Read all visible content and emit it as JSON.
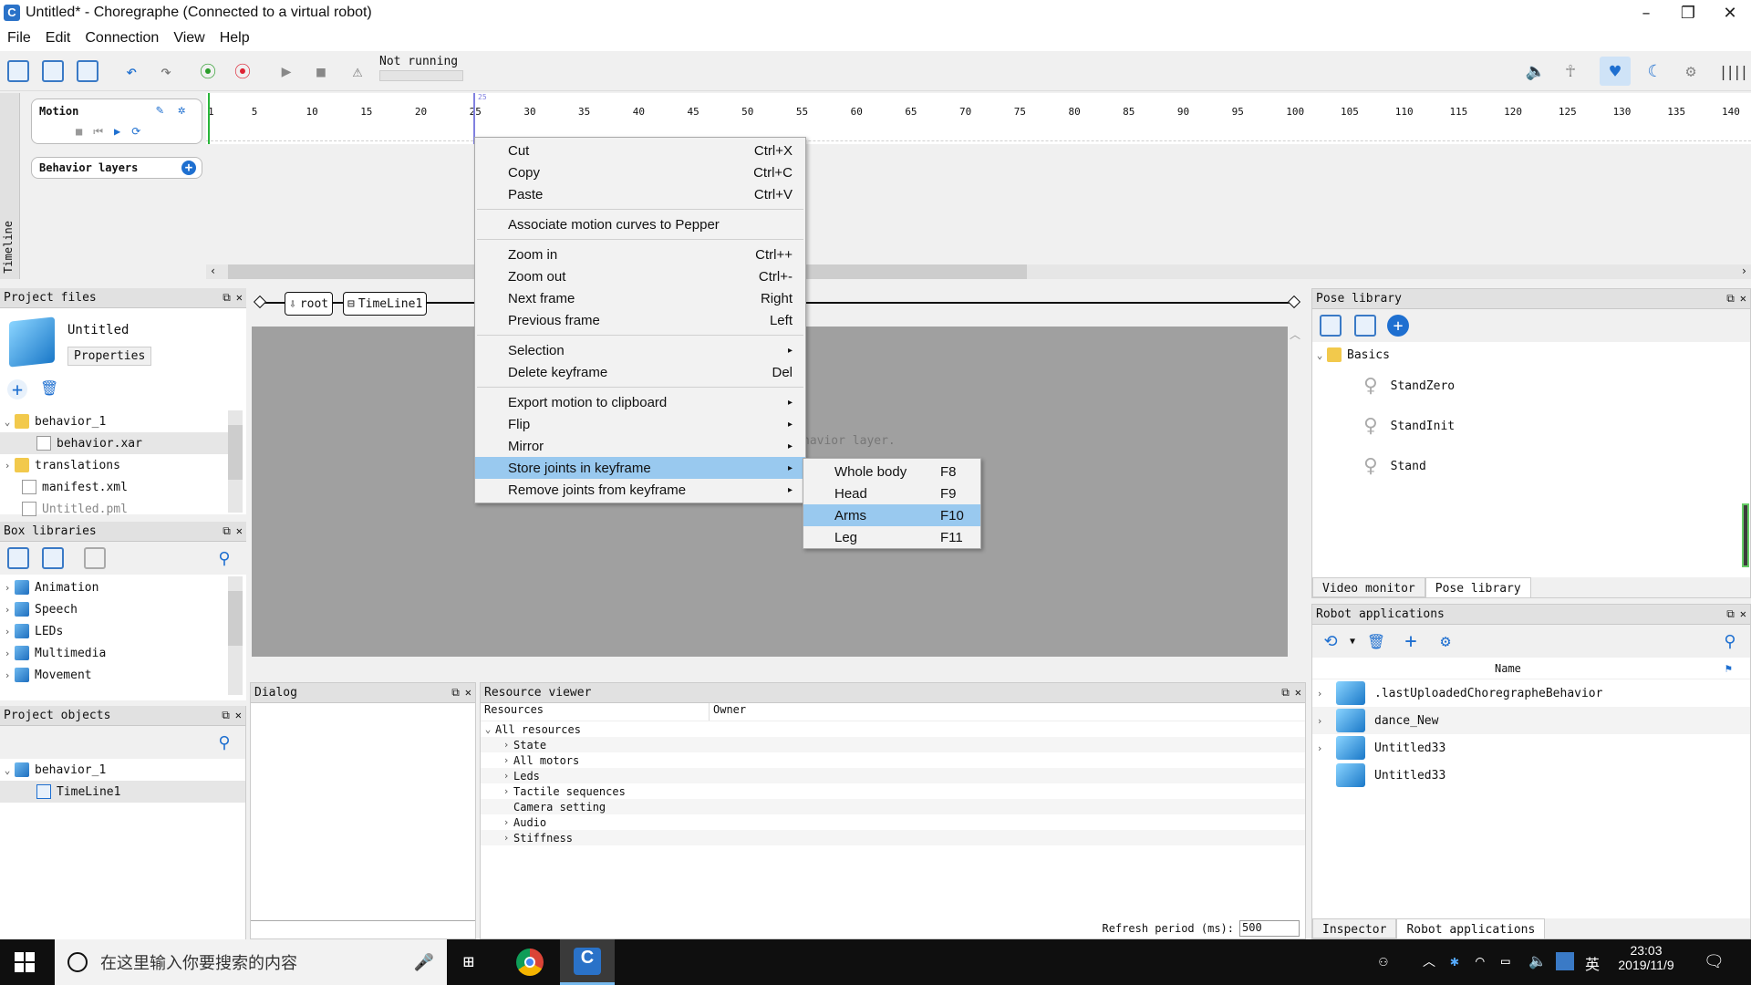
{
  "window": {
    "title": "Untitled* - Choregraphe (Connected to a virtual robot)",
    "app_icon": "C"
  },
  "menu": [
    "File",
    "Edit",
    "Connection",
    "View",
    "Help"
  ],
  "toolbar": {
    "status": "Not running"
  },
  "timeline": {
    "vertical_label": "Timeline",
    "motion_label": "Motion",
    "behavior_layers": "Behavior layers",
    "ticks": [
      "1",
      "5",
      "10",
      "15",
      "20",
      "25",
      "30",
      "35",
      "40",
      "45",
      "50",
      "55",
      "60",
      "65",
      "70",
      "75",
      "80",
      "85",
      "90",
      "95",
      "100",
      "105",
      "110",
      "115",
      "120",
      "125",
      "130",
      "135",
      "140"
    ],
    "cursor_label": "25"
  },
  "breadcrumb": {
    "root": "root",
    "timeline": "TimeLine1"
  },
  "project_files": {
    "header": "Project files",
    "project_name": "Untitled",
    "properties_btn": "Properties",
    "tree": [
      {
        "label": "behavior_1",
        "kind": "folder",
        "expanded": true
      },
      {
        "label": "behavior.xar",
        "kind": "file",
        "selected": true
      },
      {
        "label": "translations",
        "kind": "folder",
        "expanded": false
      },
      {
        "label": "manifest.xml",
        "kind": "xml"
      },
      {
        "label": "Untitled.pml",
        "kind": "pml"
      }
    ]
  },
  "box_libraries": {
    "header": "Box libraries",
    "items": [
      "Animation",
      "Speech",
      "LEDs",
      "Multimedia",
      "Movement"
    ]
  },
  "project_objects": {
    "header": "Project objects",
    "tree": [
      {
        "label": "behavior_1"
      },
      {
        "label": "TimeLine1"
      }
    ]
  },
  "canvas": {
    "hint": "havior layer."
  },
  "dialog": {
    "header": "Dialog"
  },
  "resource_viewer": {
    "header": "Resource viewer",
    "col_resources": "Resources",
    "col_owner": "Owner",
    "root": "All resources",
    "children": [
      "State",
      "All motors",
      "Leds",
      "Tactile sequences",
      "Camera setting",
      "Audio",
      "Stiffness"
    ],
    "refresh_label": "Refresh period (ms):",
    "refresh_value": "500"
  },
  "pose_library": {
    "header": "Pose library",
    "group": "Basics",
    "poses": [
      "StandZero",
      "StandInit",
      "Stand"
    ],
    "tabs": [
      "Video monitor",
      "Pose library"
    ]
  },
  "robot_applications": {
    "header": "Robot applications",
    "col_name": "Name",
    "apps": [
      ".lastUploadedChoregrapheBehavior",
      "dance_New",
      "Untitled33",
      "Untitled33"
    ],
    "tabs": [
      "Inspector",
      "Robot applications"
    ]
  },
  "context_menu": {
    "items": [
      {
        "label": "Cut",
        "shortcut": "Ctrl+X"
      },
      {
        "label": "Copy",
        "shortcut": "Ctrl+C"
      },
      {
        "label": "Paste",
        "shortcut": "Ctrl+V"
      },
      {
        "sep": true
      },
      {
        "label": "Associate motion curves to Pepper",
        "shortcut": ""
      },
      {
        "sep": true
      },
      {
        "label": "Zoom in",
        "shortcut": "Ctrl++"
      },
      {
        "label": "Zoom out",
        "shortcut": "Ctrl+-"
      },
      {
        "label": "Next frame",
        "shortcut": "Right"
      },
      {
        "label": "Previous frame",
        "shortcut": "Left"
      },
      {
        "sep": true
      },
      {
        "label": "Selection",
        "submenu": true
      },
      {
        "label": "Delete keyframe",
        "shortcut": "Del"
      },
      {
        "sep": true
      },
      {
        "label": "Export motion to clipboard",
        "submenu": true
      },
      {
        "label": "Flip",
        "submenu": true
      },
      {
        "label": "Mirror",
        "submenu": true
      },
      {
        "label": "Store joints in keyframe",
        "submenu": true,
        "highlighted": true
      },
      {
        "label": "Remove joints from keyframe",
        "submenu": true
      }
    ]
  },
  "submenu": {
    "items": [
      {
        "label": "Whole body",
        "shortcut": "F8"
      },
      {
        "label": "Head",
        "shortcut": "F9"
      },
      {
        "label": "Arms",
        "shortcut": "F10",
        "highlighted": true
      },
      {
        "label": "Leg",
        "shortcut": "F11"
      }
    ]
  },
  "taskbar": {
    "search_placeholder": "在这里输入你要搜索的内容",
    "ime": "英",
    "time": "23:03",
    "date": "2019/11/9"
  },
  "colors": {
    "menu_highlight": "#99c9ef",
    "accent": "#1e6fd0",
    "taskbar": "#0f0f0f"
  }
}
